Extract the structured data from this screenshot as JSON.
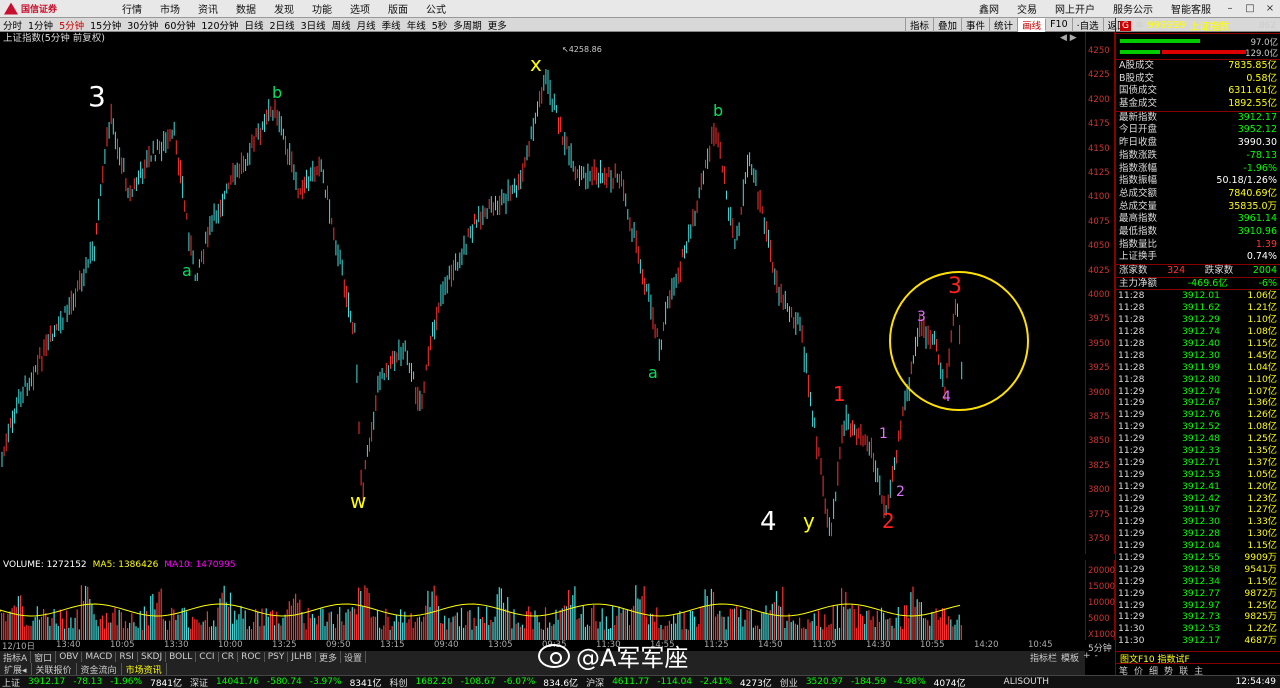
{
  "brand": {
    "name": "国信证券"
  },
  "menu": [
    "行情",
    "市场",
    "资讯",
    "数据",
    "发现",
    "功能",
    "选项",
    "版面",
    "公式"
  ],
  "menu_right": [
    "鑫网",
    "交易",
    "网上开户",
    "服务公示",
    "智能客服"
  ],
  "timeframes": [
    {
      "label": "分时"
    },
    {
      "label": "1分钟"
    },
    {
      "label": "5分钟",
      "active": true
    },
    {
      "label": "15分钟"
    },
    {
      "label": "30分钟"
    },
    {
      "label": "60分钟"
    },
    {
      "label": "120分钟"
    },
    {
      "label": "日线"
    },
    {
      "label": "2日线"
    },
    {
      "label": "3日线"
    },
    {
      "label": "周线"
    },
    {
      "label": "月线"
    },
    {
      "label": "季线"
    },
    {
      "label": "年线"
    },
    {
      "label": "5秒"
    },
    {
      "label": "多周期"
    },
    {
      "label": "更多"
    }
  ],
  "toolbar2": [
    {
      "label": "指标"
    },
    {
      "label": "叠加"
    },
    {
      "label": "事件"
    },
    {
      "label": "统计"
    },
    {
      "label": "画线",
      "active": true
    },
    {
      "label": "F10"
    },
    {
      "label": "·自选"
    },
    {
      "label": "返回"
    }
  ],
  "chart_title": "上证指数(5分钟 前复权)",
  "chart_corner": "◀ ▶",
  "price_axis": [
    "4250",
    "4225",
    "4200",
    "4175",
    "4150",
    "4125",
    "4100",
    "4075",
    "4050",
    "4025",
    "4000",
    "3975",
    "3950",
    "3925",
    "3900",
    "3875",
    "3850",
    "3825",
    "3800",
    "3775",
    "3750"
  ],
  "annotations": {
    "high_label": "4258.86",
    "waves": [
      {
        "text": "3",
        "color": "#ffffff",
        "size": 28
      },
      {
        "text": "a",
        "color": "#00e060",
        "size": 16
      },
      {
        "text": "b",
        "color": "#00e060",
        "size": 16
      },
      {
        "text": "w",
        "color": "#ffff00",
        "size": 20
      },
      {
        "text": "x",
        "color": "#ffff00",
        "size": 20
      },
      {
        "text": "a",
        "color": "#00e060",
        "size": 16
      },
      {
        "text": "b",
        "color": "#00e060",
        "size": 16
      },
      {
        "text": "4",
        "color": "#ffffff",
        "size": 26
      },
      {
        "text": "y",
        "color": "#ffff00",
        "size": 20
      },
      {
        "text": "1",
        "color": "#ff2020",
        "size": 20
      },
      {
        "text": "2",
        "color": "#ff2020",
        "size": 20
      },
      {
        "text": "1",
        "color": "#e070ff",
        "size": 14
      },
      {
        "text": "2",
        "color": "#e070ff",
        "size": 14
      },
      {
        "text": "3",
        "color": "#e070ff",
        "size": 14
      },
      {
        "text": "4",
        "color": "#e070ff",
        "size": 14
      },
      {
        "text": "3",
        "color": "#ff2020",
        "size": 22
      }
    ]
  },
  "volume_info": {
    "vol": "VOLUME: 1272152",
    "ma5": "MA5: 1386426",
    "ma10": "MA10: 1470995"
  },
  "volume_axis": [
    "20000",
    "15000",
    "10000",
    "5000",
    "X1000"
  ],
  "time_axis": [
    "12/10日",
    "13:40",
    "10:05",
    "13:30",
    "10:00",
    "13:25",
    "09:50",
    "13:15",
    "09:40",
    "13:05",
    "09:35",
    "11:30",
    "14:55",
    "11:25",
    "14:50",
    "11:05",
    "14:30",
    "10:55",
    "14:20",
    "10:45"
  ],
  "indicators1": [
    "指标A",
    "窗口",
    "OBV",
    "MACD",
    "RSI",
    "SKDJ",
    "BOLL",
    "CCI",
    "CR",
    "ROC",
    "PSY",
    "JLHB",
    "更多",
    "设置"
  ],
  "indicators2": [
    {
      "label": "扩展◂"
    },
    {
      "label": "关联报价"
    },
    {
      "label": "资金流向"
    },
    {
      "label": "市场资讯",
      "active": true
    }
  ],
  "indright": [
    "指标栏",
    "模板",
    "+",
    "-"
  ],
  "five_min": "5分钟",
  "right_panel": {
    "code": "999999",
    "name": "上证指数",
    "badge": "862",
    "bar1_label": "97.0亿",
    "bar2_label": "129.0亿",
    "vol_section": [
      {
        "label": "A股成交",
        "value": "7835.85亿",
        "cls": "yellow"
      },
      {
        "label": "B股成交",
        "value": "0.58亿",
        "cls": "yellow"
      },
      {
        "label": "国债成交",
        "value": "6311.61亿",
        "cls": "yellow"
      },
      {
        "label": "基金成交",
        "value": "1892.55亿",
        "cls": "yellow"
      }
    ],
    "stats": [
      {
        "label": "最新指数",
        "value": "3912.17",
        "cls": "down"
      },
      {
        "label": "今日开盘",
        "value": "3952.12",
        "cls": "down"
      },
      {
        "label": "昨日收盘",
        "value": "3990.30",
        "cls": "white"
      },
      {
        "label": "指数涨跌",
        "value": "-78.13",
        "cls": "down"
      },
      {
        "label": "指数涨幅",
        "value": "-1.96%",
        "cls": "down"
      },
      {
        "label": "指数振幅",
        "value": "50.18/1.26%",
        "cls": "white"
      },
      {
        "label": "总成交额",
        "value": "7840.69亿",
        "cls": "yellow"
      },
      {
        "label": "总成交量",
        "value": "35835.0万",
        "cls": "yellow"
      },
      {
        "label": "最高指数",
        "value": "3961.14",
        "cls": "down"
      },
      {
        "label": "最低指数",
        "value": "3910.96",
        "cls": "down"
      },
      {
        "label": "指数量比",
        "value": "1.39",
        "cls": "up"
      },
      {
        "label": "上证换手",
        "value": "0.74%",
        "cls": "white"
      }
    ],
    "breadth": {
      "up_label": "涨家数",
      "up": "324",
      "down_label": "跌家数",
      "down": "2004"
    },
    "flow": {
      "label": "主力净额",
      "value": "-469.6亿",
      "pct": "-6%"
    },
    "ticks": [
      {
        "t": "11:28",
        "p": "3912.01",
        "v": "1.06亿"
      },
      {
        "t": "11:28",
        "p": "3911.62",
        "v": "1.21亿"
      },
      {
        "t": "11:28",
        "p": "3912.29",
        "v": "1.10亿"
      },
      {
        "t": "11:28",
        "p": "3912.74",
        "v": "1.08亿"
      },
      {
        "t": "11:28",
        "p": "3912.40",
        "v": "1.15亿"
      },
      {
        "t": "11:28",
        "p": "3912.30",
        "v": "1.45亿"
      },
      {
        "t": "11:28",
        "p": "3911.99",
        "v": "1.04亿"
      },
      {
        "t": "11:28",
        "p": "3912.80",
        "v": "1.10亿"
      },
      {
        "t": "11:29",
        "p": "3912.74",
        "v": "1.07亿"
      },
      {
        "t": "11:29",
        "p": "3912.67",
        "v": "1.36亿"
      },
      {
        "t": "11:29",
        "p": "3912.76",
        "v": "1.26亿"
      },
      {
        "t": "11:29",
        "p": "3912.52",
        "v": "1.08亿"
      },
      {
        "t": "11:29",
        "p": "3912.48",
        "v": "1.25亿"
      },
      {
        "t": "11:29",
        "p": "3912.33",
        "v": "1.35亿"
      },
      {
        "t": "11:29",
        "p": "3912.71",
        "v": "1.37亿"
      },
      {
        "t": "11:29",
        "p": "3912.53",
        "v": "1.05亿"
      },
      {
        "t": "11:29",
        "p": "3912.41",
        "v": "1.20亿"
      },
      {
        "t": "11:29",
        "p": "3912.42",
        "v": "1.23亿"
      },
      {
        "t": "11:29",
        "p": "3911.97",
        "v": "1.27亿"
      },
      {
        "t": "11:29",
        "p": "3912.30",
        "v": "1.33亿"
      },
      {
        "t": "11:29",
        "p": "3912.28",
        "v": "1.30亿"
      },
      {
        "t": "11:29",
        "p": "3912.04",
        "v": "1.15亿"
      },
      {
        "t": "11:29",
        "p": "3912.55",
        "v": "9909万"
      },
      {
        "t": "11:29",
        "p": "3912.58",
        "v": "9541万"
      },
      {
        "t": "11:29",
        "p": "3912.34",
        "v": "1.15亿"
      },
      {
        "t": "11:29",
        "p": "3912.77",
        "v": "9872万"
      },
      {
        "t": "11:29",
        "p": "3912.97",
        "v": "1.25亿"
      },
      {
        "t": "11:29",
        "p": "3912.73",
        "v": "9825万"
      },
      {
        "t": "11:30",
        "p": "3912.53",
        "v": "1.22亿"
      },
      {
        "t": "11:30",
        "p": "3912.17",
        "v": "4687万"
      }
    ],
    "foot": [
      "笔",
      "价",
      "细",
      "势",
      "联",
      "主"
    ],
    "foot2": "图文F10 指数试F"
  },
  "status": [
    {
      "name": "上证",
      "val": "3912.17",
      "chg": "-78.13",
      "pct": "-1.96%",
      "amt": "7841亿"
    },
    {
      "name": "深证",
      "val": "14041.76",
      "chg": "-580.74",
      "pct": "-3.97%",
      "amt": "8341亿"
    },
    {
      "name": "科创",
      "val": "1682.20",
      "chg": "-108.67",
      "pct": "-6.07%",
      "amt": "834.6亿"
    },
    {
      "name": "沪深",
      "val": "4611.77",
      "chg": "-114.04",
      "pct": "-2.41%",
      "amt": "4273亿"
    },
    {
      "name": "创业",
      "val": "3520.97",
      "chg": "-184.59",
      "pct": "-4.98%",
      "amt": "4074亿"
    }
  ],
  "status_right": {
    "src": "ALISOUTH",
    "time": "12:54:49"
  },
  "watermark": "@A军军座"
}
